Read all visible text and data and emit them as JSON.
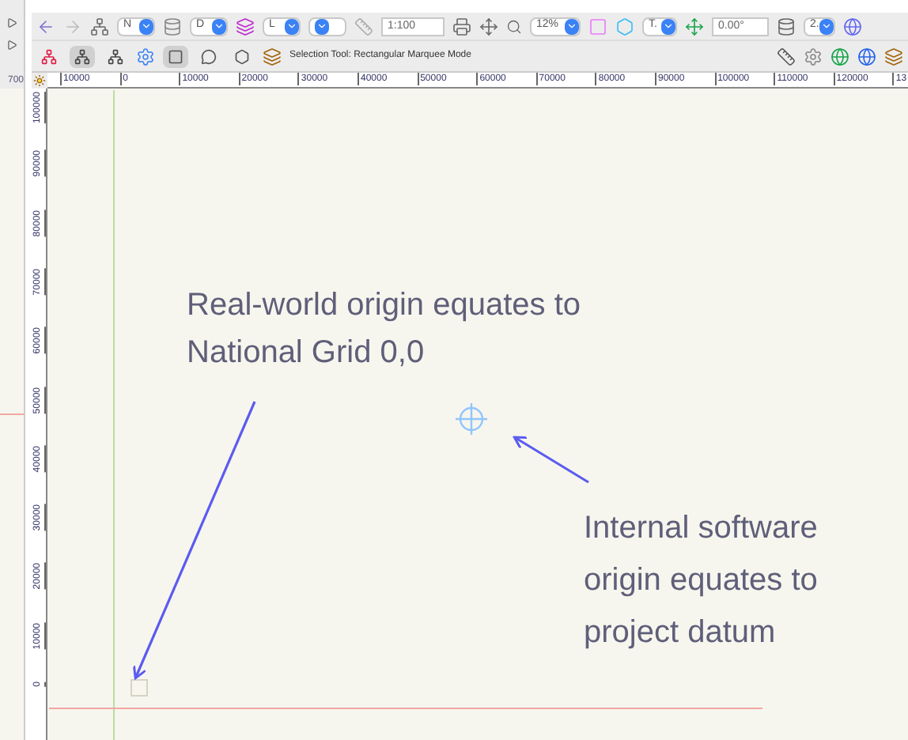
{
  "left_pane": {
    "ruler_label": "700"
  },
  "toolbar": {
    "fields": [
      {
        "kind": "dropdown",
        "value": "N"
      },
      {
        "kind": "dropdown",
        "value": "D"
      },
      {
        "kind": "dropdown",
        "value": "L"
      },
      {
        "kind": "dropdown"
      },
      {
        "kind": "text",
        "value": "1:100"
      },
      {
        "kind": "dropdown",
        "value": "12%"
      },
      {
        "kind": "dropdown",
        "value": "T."
      },
      {
        "kind": "text",
        "value": "0.00°"
      },
      {
        "kind": "dropdown",
        "value": "2."
      }
    ]
  },
  "mode_bar": {
    "tool_modes": [
      {
        "selected": false
      },
      {
        "selected": true
      },
      {
        "selected": false
      }
    ],
    "selection_shapes": [
      {
        "selected": true
      },
      {
        "selected": false
      },
      {
        "selected": false
      }
    ],
    "mode_label": "Selection Tool: Rectangular Marquee Mode"
  },
  "rulers": {
    "horizontal": [
      "10000",
      "0",
      "10000",
      "20000",
      "30000",
      "40000",
      "50000",
      "60000",
      "70000",
      "80000",
      "90000",
      "100000",
      "110000",
      "120000",
      "13"
    ],
    "vertical": [
      "100000",
      "90000",
      "80000",
      "70000",
      "60000",
      "50000",
      "40000",
      "30000",
      "20000",
      "10000",
      "0"
    ]
  },
  "annotations": [
    {
      "text": "Real-world origin equates to National Grid 0,0"
    },
    {
      "text": "Internal software origin equates to project datum"
    }
  ]
}
